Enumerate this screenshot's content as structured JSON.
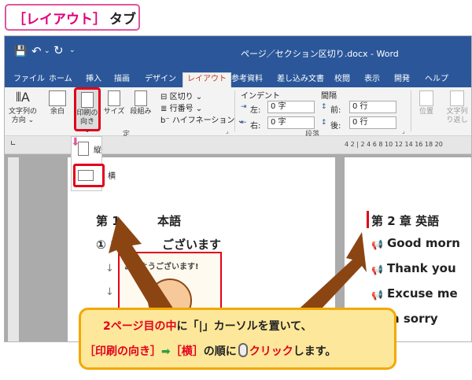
{
  "tag": {
    "open": "［",
    "name": "レイアウト",
    "close": "］",
    "suffix": "タブ"
  },
  "titlebar": {
    "doc_title": "ページ／セクション区切り.docx  -  Word"
  },
  "tabs": [
    "ファイル",
    "ホーム",
    "挿入",
    "描画",
    "デザイン",
    "レイアウト",
    "参考資料",
    "差し込み文書",
    "校閲",
    "表示",
    "開発",
    "ヘルプ"
  ],
  "ribbon": {
    "text_direction": [
      "文字列の",
      "方向 ⌄"
    ],
    "margins": "余白",
    "orientation": [
      "印刷の",
      "向き ⌄"
    ],
    "size": "サイズ",
    "columns": "段組み",
    "breaks": "区切り ⌄",
    "line_numbers": "行番号 ⌄",
    "hyphenation": "ハイフネーション ⌄",
    "group_setup": "定",
    "indent_title": "インデント",
    "spacing_title": "間隔",
    "indent_left_label": "左:",
    "indent_left_value": "0 字",
    "indent_right_label": "右:",
    "indent_right_value": "0 字",
    "space_before_label": "前:",
    "space_before_value": "0 行",
    "space_after_label": "後:",
    "space_after_value": "0 行",
    "group_paragraph": "段落",
    "position": "位置",
    "wrap": [
      "文字列",
      "り返し"
    ]
  },
  "dropdown": {
    "portrait": "縦",
    "landscape": "横"
  },
  "ruler_numbers": "4  2  |  2  4  6  8  10  12  14  16  18  20",
  "page1": {
    "heading": "第 1",
    "heading_tail": "本語",
    "line2": "① おは",
    "line2_tail": "ございます",
    "arrow_glyph": "↓",
    "badge": "おはようございます!"
  },
  "page2": {
    "heading": "第 2 章  英語",
    "lines": [
      "Good morn",
      "Thank you",
      "Excuse me",
      "m sorry"
    ]
  },
  "callout": {
    "line1_red": "2ページ目の中",
    "line1_mid": "に",
    "line1_quote": "「|」",
    "line1_rest": "カーソルを置いて、",
    "line2_a": "［印刷の向き］",
    "line2_arrow": "➡",
    "line2_b": "［横］",
    "line2_mid": "の順に",
    "line2_red": "クリック",
    "line2_end": "します。"
  },
  "colors": {
    "word_blue": "#2b579a",
    "accent_red": "#e2001a",
    "callout_bg": "#fde79a",
    "arrow_brown": "#8b4513"
  }
}
